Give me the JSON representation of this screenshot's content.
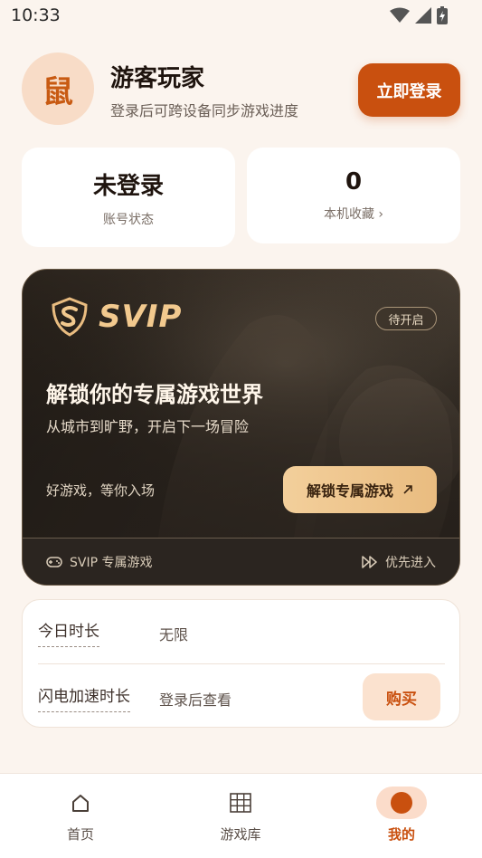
{
  "status_bar": {
    "time": "10:33"
  },
  "profile": {
    "avatar_glyph": "鼠",
    "name": "游客玩家",
    "subtitle": "登录后可跨设备同步游戏进度",
    "login_label": "立即登录"
  },
  "stats": [
    {
      "value": "未登录",
      "label": "账号状态"
    },
    {
      "value": "0",
      "label": "本机收藏 ›"
    }
  ],
  "svip": {
    "logo_text": "SVIP",
    "badge": "待开启",
    "title": "解锁你的专属游戏世界",
    "subtitle": "从城市到旷野，开启下一场冒险",
    "hint": "好游戏，等你入场",
    "unlock_label": "解锁专属游戏",
    "footer_left": "SVIP 专属游戏",
    "footer_right": "优先进入"
  },
  "time_card": {
    "rows": [
      {
        "label": "今日时长",
        "value": "无限"
      },
      {
        "label": "闪电加速时长",
        "value": "登录后查看"
      }
    ],
    "buy_label": "购买"
  },
  "nav": {
    "items": [
      {
        "label": "首页",
        "icon": "home-icon"
      },
      {
        "label": "游戏库",
        "icon": "grid-icon"
      },
      {
        "label": "我的",
        "icon": "profile-dot-icon",
        "active": true
      }
    ]
  },
  "colors": {
    "accent": "#c9500f",
    "background": "#fbf4ee",
    "svip_gold": "#f2c98e"
  }
}
